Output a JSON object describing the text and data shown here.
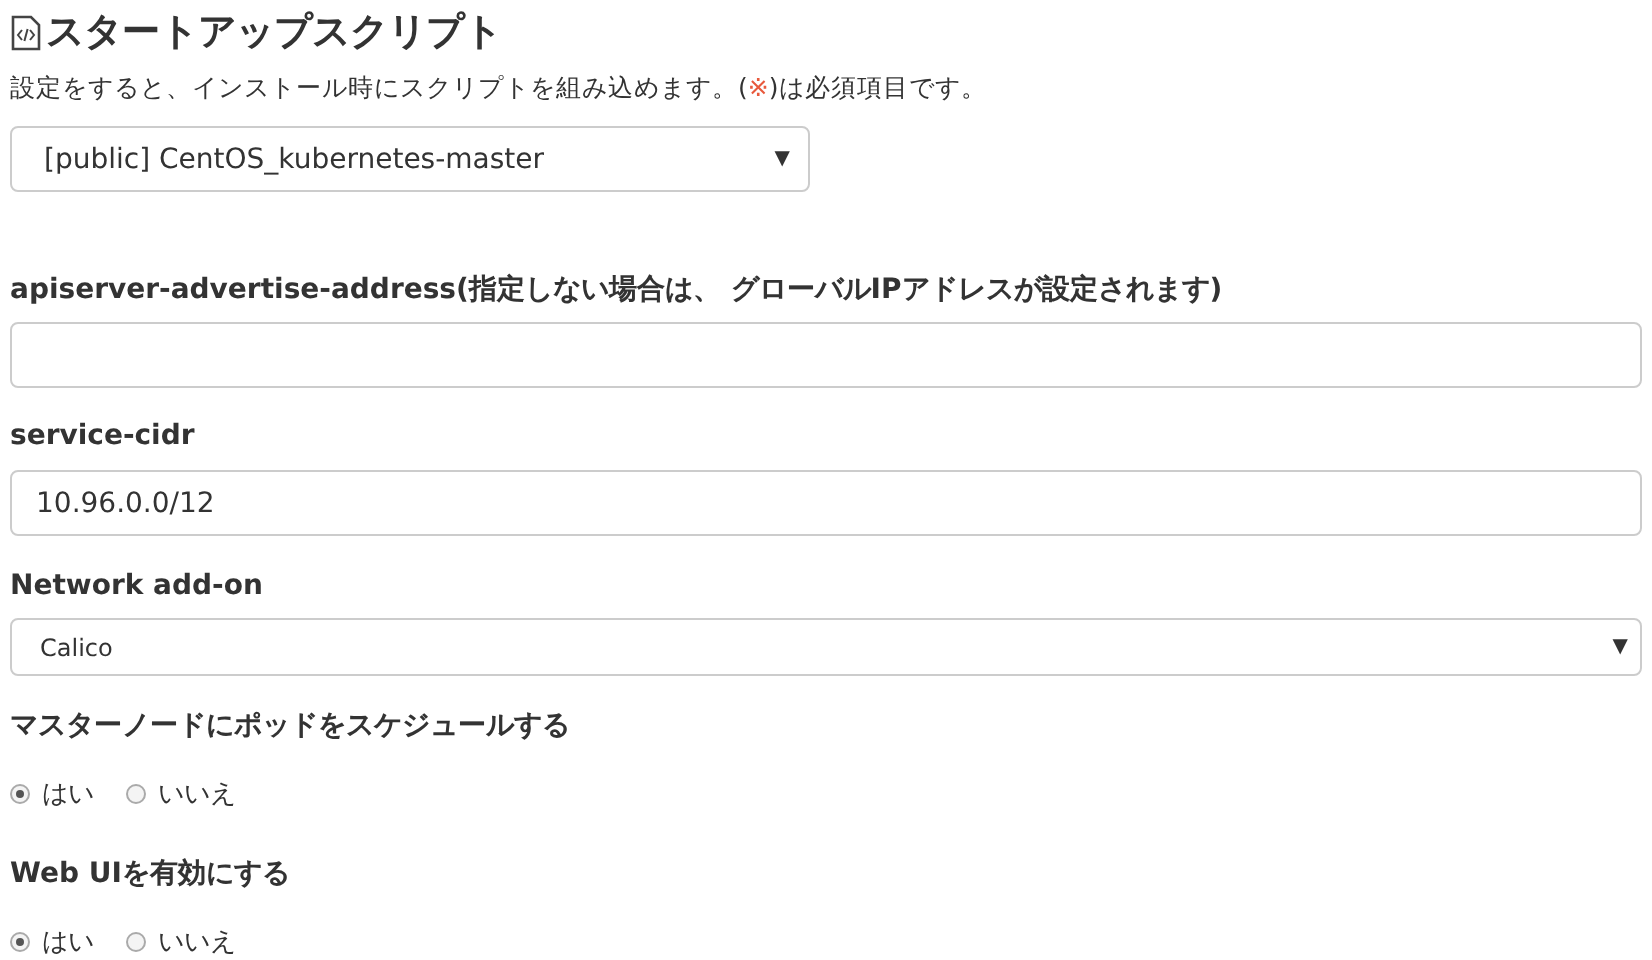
{
  "title": "スタートアップスクリプト",
  "description": {
    "before": "設定をすると、インストール時にスクリプトを組み込めます。(",
    "mark": "※",
    "after": ")は必須項目です。"
  },
  "script_select": {
    "value": "[public] CentOS_kubernetes-master",
    "arrow": "▼"
  },
  "fields": [
    {
      "kind": "text",
      "label": "apiserver-advertise-address(指定しない場合は、 グローバルIPアドレスが設定されます)"
    },
    {
      "kind": "text",
      "label": "service-cidr",
      "value": "10.96.0.0/12"
    },
    {
      "kind": "select",
      "label": "Network add-on",
      "value": "Calico",
      "arrow": "▼"
    },
    {
      "kind": "radio",
      "label": "マスターノードにポッドをスケジュールする",
      "options": [
        {
          "label": "はい",
          "selected": true
        },
        {
          "label": "いいえ",
          "selected": false
        }
      ]
    },
    {
      "kind": "radio",
      "label": "Web UIを有効にする",
      "options": [
        {
          "label": "はい",
          "selected": true
        },
        {
          "label": "いいえ",
          "selected": false
        }
      ]
    }
  ]
}
